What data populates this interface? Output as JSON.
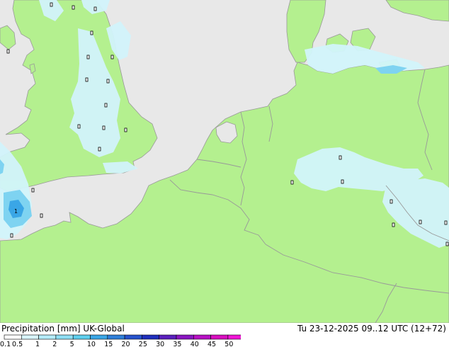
{
  "footer": {
    "title": "Precipitation [mm]  UK-Global",
    "valid_time": "Tu 23-12-2025 09..12 UTC (12+72)"
  },
  "legend": {
    "labels": [
      "0.1",
      "0.5",
      "1",
      "2",
      "5",
      "10",
      "15",
      "20",
      "25",
      "30",
      "35",
      "40",
      "45",
      "50"
    ],
    "colors": [
      "#ffffff",
      "#d9f5fb",
      "#b5ecf8",
      "#8fdff4",
      "#5fcfee",
      "#3aa6e6",
      "#2f7fd9",
      "#2652cc",
      "#1f2fbd",
      "#5a1fbd",
      "#8a16c1",
      "#b711c4",
      "#d80fbf",
      "#f015d6"
    ]
  },
  "map": {
    "land_color": "#b4f08f",
    "sea_color": "#e8e8e8",
    "precip_light": "#d2f4fb",
    "precip_mid": "#7ed3f1",
    "precip_heavy": "#3aa6e6",
    "rain_label": "1"
  }
}
